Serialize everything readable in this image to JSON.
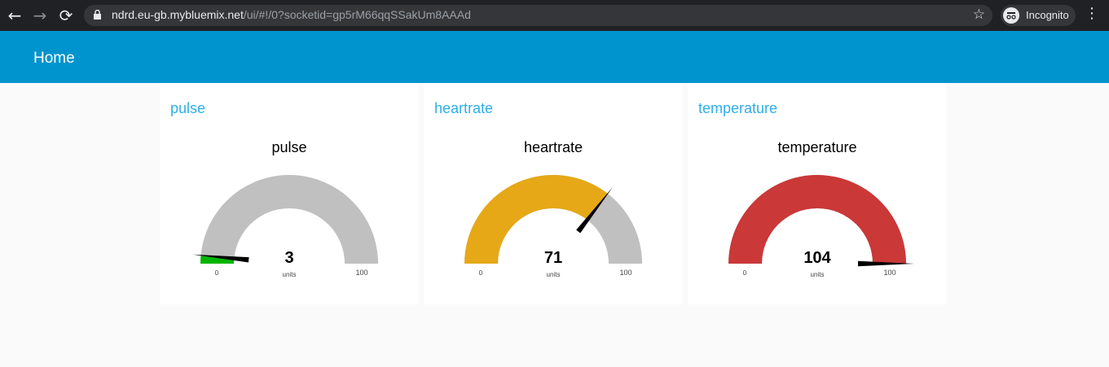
{
  "browser": {
    "url_host": "ndrd.eu-gb.mybluemix.net",
    "url_path": "/ui/#!/0?socketid=gp5rM66qqSSakUm8AAAd",
    "incognito_label": "Incognito",
    "icons": [
      "back-arrow-icon",
      "forward-arrow-icon",
      "reload-icon",
      "lock-icon",
      "star-icon",
      "incognito-icon",
      "kebab-menu-icon"
    ]
  },
  "header": {
    "title": "Home"
  },
  "cards": [
    {
      "group": "pulse",
      "label": "pulse",
      "value": 3,
      "value_text": "3",
      "units": "units",
      "min": 0,
      "max": 100,
      "min_text": "0",
      "max_text": "100",
      "color": "#00b500"
    },
    {
      "group": "heartrate",
      "label": "heartrate",
      "value": 71,
      "value_text": "71",
      "units": "units",
      "min": 0,
      "max": 100,
      "min_text": "0",
      "max_text": "100",
      "color": "#e6a817"
    },
    {
      "group": "temperature",
      "label": "temperature",
      "value": 104,
      "value_text": "104",
      "units": "units",
      "min": 0,
      "max": 100,
      "min_text": "0",
      "max_text": "100",
      "color": "#ca3838"
    }
  ],
  "colors": {
    "toolbar": "#0094ce",
    "group_title": "#2eaee9",
    "gauge_track": "#c0c0c0",
    "needle": "#000000"
  }
}
